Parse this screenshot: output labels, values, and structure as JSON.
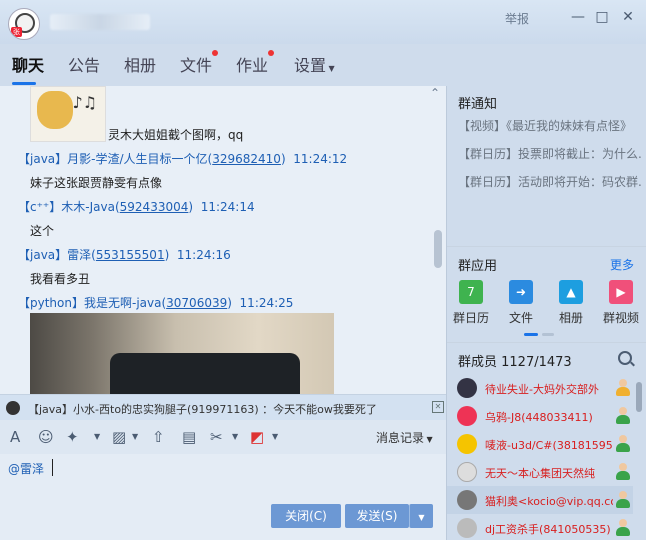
{
  "window": {
    "report": "举报",
    "min": "—",
    "max": "□",
    "close": "✕",
    "avatar_tag": "张"
  },
  "tabs": [
    {
      "label": "聊天"
    },
    {
      "label": "公告"
    },
    {
      "label": "相册"
    },
    {
      "label": "文件"
    },
    {
      "label": "作业"
    },
    {
      "label": "设置"
    }
  ],
  "chat": {
    "messages": [
      {
        "text": "灵木大姐姐截个图啊，qq"
      },
      {
        "tag": "【java】",
        "name": "月影-学渣/人生目标一个亿",
        "qq": "329682410",
        "time": "11:24:12",
        "text": "妹子这张跟贾静雯有点像"
      },
      {
        "tag": "【c⁺⁺】",
        "name": "木木-Java",
        "qq": "592433004",
        "time": "11:24:14",
        "text": "这个"
      },
      {
        "tag": "【java】",
        "name": "雷泽",
        "qq": "553155501",
        "time": "11:24:16",
        "text": "我看看多丑"
      },
      {
        "tag": "【python】",
        "name": "我是无啊-java",
        "qq": "30706039",
        "time": "11:24:25"
      }
    ]
  },
  "notice_bar": {
    "text": "【java】小水-西to的忠实狗腿子(919971163) ：今天不能ow我要死了"
  },
  "toolbar": {
    "history": "消息记录"
  },
  "input": {
    "value": "@雷泽"
  },
  "buttons": {
    "close": "关闭(C)",
    "send": "发送(S)"
  },
  "group_notice": {
    "title": "群通知",
    "items": [
      "【视频】《最近我的妹妹有点怪》",
      "【群日历】投票即将截止：为什么...",
      "【群日历】活动即将开始：码农群..."
    ]
  },
  "group_apps": {
    "title": "群应用",
    "more": "更多",
    "apps": [
      {
        "label": "群日历",
        "icon": "calendar-icon",
        "color": "#3fb34f",
        "glyph": "7"
      },
      {
        "label": "文件",
        "icon": "file-icon",
        "color": "#2b8be0",
        "glyph": "➜"
      },
      {
        "label": "相册",
        "icon": "album-icon",
        "color": "#1d9ee0",
        "glyph": "▲"
      },
      {
        "label": "群视频",
        "icon": "video-icon",
        "color": "#f0507a",
        "glyph": "▶"
      }
    ]
  },
  "members": {
    "title": "群成员 1127/1473",
    "list": [
      {
        "name": "待业失业-大妈外交部外",
        "color": "#d81e1e",
        "avatar": "#334"
      },
      {
        "name": "乌鸦-J8(448033411)",
        "color": "#d81e1e",
        "avatar": "#e35"
      },
      {
        "name": "唛液-u3d/C#(381815955",
        "color": "#d81e1e",
        "avatar": "#f5c400"
      },
      {
        "name": "无天～本心集团天然纯",
        "color": "#d81e1e",
        "avatar": "#ddd"
      },
      {
        "name": "猫利奥<kocio@vip.qq.co",
        "color": "#d81e1e",
        "avatar": "#777"
      },
      {
        "name": "dj工资杀手(841050535)",
        "color": "#d81e1e",
        "avatar": "#bbb"
      }
    ]
  }
}
